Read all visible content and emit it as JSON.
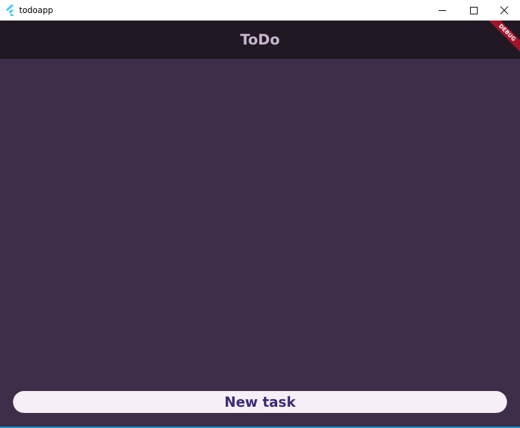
{
  "window": {
    "title": "todoapp",
    "icon": "flutter-logo-icon",
    "controls": {
      "minimize_icon": "minimize-icon",
      "maximize_icon": "maximize-icon",
      "close_icon": "close-icon"
    }
  },
  "appbar": {
    "title": "ToDo",
    "background": "#201924",
    "title_color": "#c7b6cf"
  },
  "debug_banner": {
    "label": "DEBUG",
    "color": "#a2142a"
  },
  "body": {
    "background": "#3e2e4a"
  },
  "actions": {
    "new_task_label": "New task",
    "button_background": "#f6eff7",
    "button_text_color": "#3f2a74"
  }
}
